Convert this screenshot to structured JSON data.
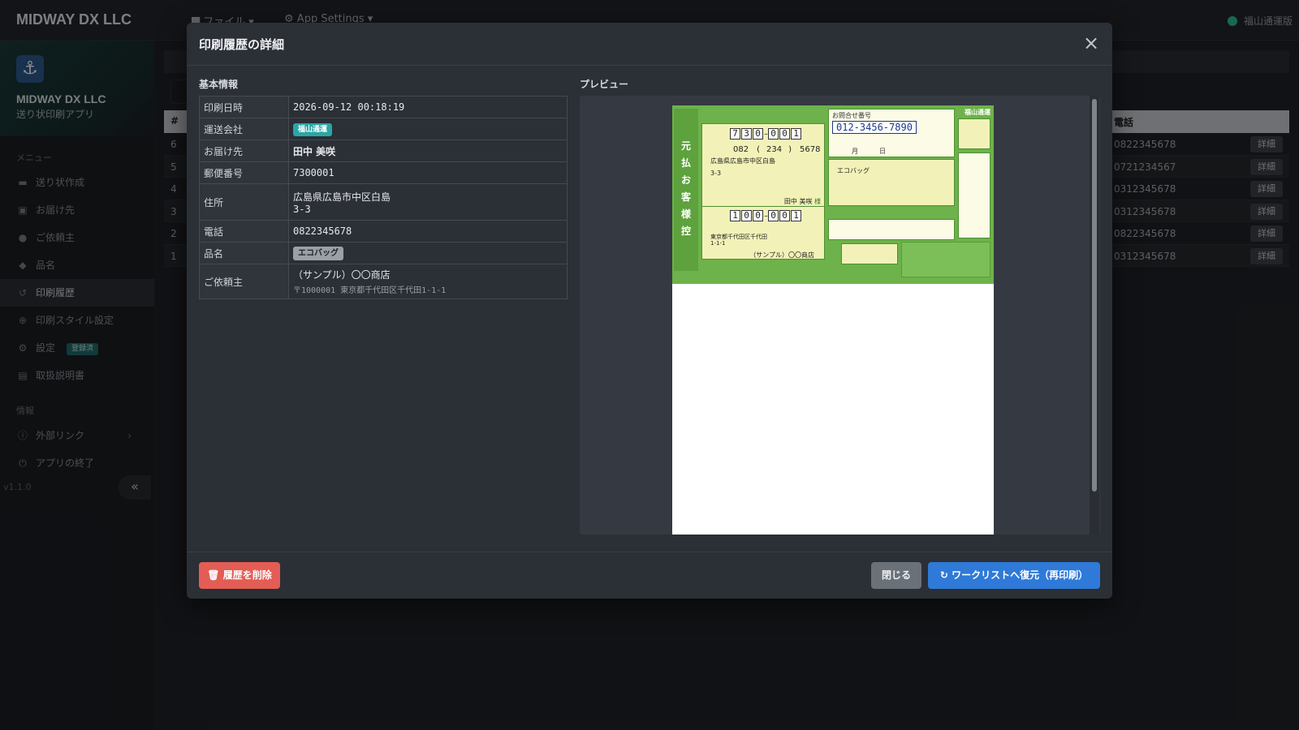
{
  "app": {
    "brand": "MIDWAY DX LLC",
    "menu_file": "ファイル",
    "menu_settings": "App Settings",
    "carrier_mode": "福山通運版"
  },
  "sidebar": {
    "company": "MIDWAY DX LLC",
    "subtitle": "送り状印刷アプリ",
    "section_menu": "メニュー",
    "items": [
      {
        "label": "送り状作成"
      },
      {
        "label": "お届け先"
      },
      {
        "label": "ご依頼主"
      },
      {
        "label": "品名"
      },
      {
        "label": "印刷履歴"
      },
      {
        "label": "印刷スタイル設定"
      },
      {
        "label": "設定",
        "badge": "登録済"
      },
      {
        "label": "取扱説明書"
      }
    ],
    "section_info": "情報",
    "info_items": [
      {
        "label": "外部リンク"
      },
      {
        "label": "アプリの終了"
      }
    ],
    "version": "v1.1.0",
    "collapse": "«"
  },
  "background_table": {
    "col_hash": "#",
    "col_tel": "電話",
    "detail_label": "詳細",
    "rows": [
      {
        "num": "6",
        "tel": "0822345678"
      },
      {
        "num": "5",
        "tel": "0721234567"
      },
      {
        "num": "4",
        "tel": "0312345678"
      },
      {
        "num": "3",
        "tel": "0312345678"
      },
      {
        "num": "2",
        "tel": "0822345678"
      },
      {
        "num": "1",
        "tel": "0312345678"
      }
    ]
  },
  "modal": {
    "title": "印刷履歴の詳細",
    "close_glyph": "×",
    "basic_info_label": "基本情報",
    "preview_label": "プレビュー",
    "info": {
      "printed_at_label": "印刷日時",
      "printed_at": "2026-09-12 00:18:19",
      "carrier_label": "運送会社",
      "carrier": "福山通運",
      "recipient_label": "お届け先",
      "recipient": "田中 美咲",
      "zip_label": "郵便番号",
      "zip": "7300001",
      "address_label": "住所",
      "address_line1": "広島県広島市中区白島",
      "address_line2": "3-3",
      "phone_label": "電話",
      "phone": "0822345678",
      "item_label": "品名",
      "item": "エコバッグ",
      "sender_label": "ご依頼主",
      "sender_name": "（サンプル）〇〇商店",
      "sender_address": "〒1000001 東京都千代田区千代田1-1-1"
    },
    "label_preview": {
      "strip_text": "元払お客様控",
      "tracking_caption": "お問合せ番号",
      "tracking_number": "012-3456-7890",
      "carrier_name": "福山通運",
      "to_zip_digits": [
        "7",
        "3",
        "0",
        "0",
        "0",
        "1"
      ],
      "to_phone_parts": [
        "082",
        "234",
        "5678"
      ],
      "to_address": "広島県広島市中区白島",
      "to_address2": "3-3",
      "to_name": "田中 美咲",
      "to_honorific": "様",
      "item": "エコバッグ",
      "from_zip_digits": [
        "1",
        "0",
        "0",
        "0",
        "0",
        "1"
      ],
      "from_address": "東京都千代田区千代田",
      "from_address2": "1-1-1",
      "from_name": "（サンプル）〇〇商店",
      "date_month": "月",
      "date_day": "日"
    },
    "buttons": {
      "delete": "履歴を削除",
      "close": "閉じる",
      "restore": "ワークリストへ復元（再印刷）"
    }
  }
}
